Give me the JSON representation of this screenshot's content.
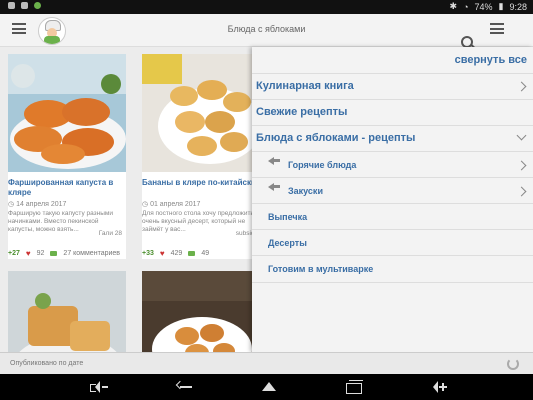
{
  "status_bar": {
    "battery": "74%",
    "time": "9:28"
  },
  "appbar": {
    "title": "Блюда с яблоками"
  },
  "cards": [
    {
      "title": "Фаршированная капуста в кляре",
      "date": "14 апреля 2017",
      "desc": "Фарширую такую капусту разными начинками. Вместо пекинской капусты, можно взять...",
      "author": "Гали 28",
      "plus": "+27",
      "likes": "92",
      "comments": "27 комментариев"
    },
    {
      "title": "Бананы в кляре по-китайски",
      "date": "01 апреля 2017",
      "desc": "Для постного стола хочу предложить очень вкусный десерт, который не займёт у вас...",
      "author": "subsidi",
      "plus": "+33",
      "likes": "429",
      "comments": "49"
    }
  ],
  "menu": {
    "collapse_label": "свернуть все",
    "items": [
      {
        "label": "Кулинарная книга"
      },
      {
        "label": "Свежие рецепты"
      },
      {
        "label": "Блюда с яблоками - рецепты"
      },
      {
        "label": "Горячие блюда"
      },
      {
        "label": "Закуски"
      },
      {
        "label": "Выпечка"
      },
      {
        "label": "Десерты"
      },
      {
        "label": "Готовим в мультиварке"
      }
    ]
  },
  "bottom": {
    "message": "Опубликовано по дате"
  }
}
